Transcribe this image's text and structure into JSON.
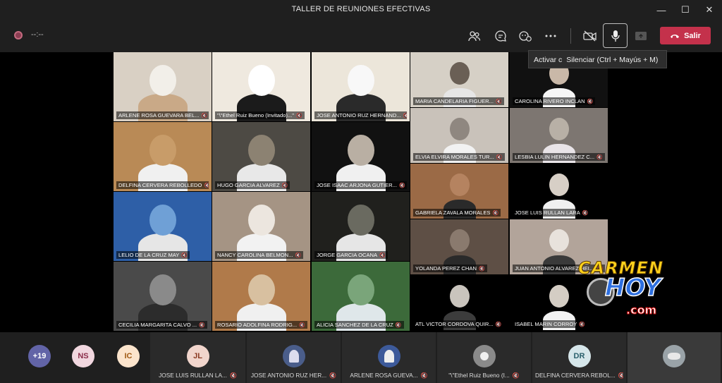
{
  "window": {
    "title": "TALLER DE REUNIONES EFECTIVAS"
  },
  "toolbar": {
    "timer": "--:--",
    "leave_label": "Salir",
    "tooltip_prefix": "Activar c",
    "tooltip_text": "Silenciar (Ctrl + Mayús + M)",
    "icons": [
      "participants-icon",
      "chat-icon",
      "reactions-icon",
      "more-icon",
      "camera-off-icon",
      "mic-icon",
      "share-icon"
    ]
  },
  "tiles": [
    {
      "name": "ARLENE ROSA GUEVARA BEL..."
    },
    {
      "name": "\"\\\"Ethel Ruiz Bueno (Invitado)...\""
    },
    {
      "name": "JOSE ANTONIO RUZ HERNAND..."
    },
    {
      "name": "MARIA CANDELARIA FIGUER..."
    },
    {
      "name": "CAROLINA RIVERO INCLAN"
    },
    {
      "name": "DELFINA CERVERA REBOLLEDO"
    },
    {
      "name": "HUGO GARCIA ALVAREZ"
    },
    {
      "name": "JOSE ISAAC ARJONA GUTIER..."
    },
    {
      "name": "ELVIA ELVIRA MORALES TUR..."
    },
    {
      "name": "LESBIA LULIN HERNANDEZ C..."
    },
    {
      "name": "GABRIELA ZAVALA MORALES"
    },
    {
      "name": "JOSE LUIS RULLAN LARA"
    },
    {
      "name": "LELIO DE LA CRUZ MAY"
    },
    {
      "name": "NANCY CAROLINA BELMON..."
    },
    {
      "name": "JORGE GARCIA OCANA"
    },
    {
      "name": "YOLANDA PEREZ CHAN"
    },
    {
      "name": "JUAN ANTONIO ALVAREZ HEL..."
    },
    {
      "name": "CECILIA MARGARITA CALVO ..."
    },
    {
      "name": "ROSARIO ADOLFINA RODRIG..."
    },
    {
      "name": "ALICIA SANCHEZ DE LA CRUZ"
    },
    {
      "name": "ATL VICTOR CORDOVA QUIR..."
    },
    {
      "name": "ISABEL MARIN CORROY"
    }
  ],
  "watermark": {
    "line1": "CARMEN",
    "line2": "HOY",
    "line3": ".com"
  },
  "bottom": {
    "overflow": "+19",
    "avatars": [
      "NS",
      "IC"
    ],
    "cards": [
      {
        "initials": "JL",
        "name": "JOSE LUIS RULLAN LA..."
      },
      {
        "initials": "",
        "name": "JOSE ANTONIO RUZ HER..."
      },
      {
        "initials": "",
        "name": "ARLENE ROSA GUEVA..."
      },
      {
        "initials": "",
        "name": "\"\\\"Ethel Ruiz Bueno (I..."
      },
      {
        "initials": "DR",
        "name": "DELFINA CERVERA REBOL..."
      },
      {
        "initials": "",
        "name": ""
      }
    ]
  }
}
